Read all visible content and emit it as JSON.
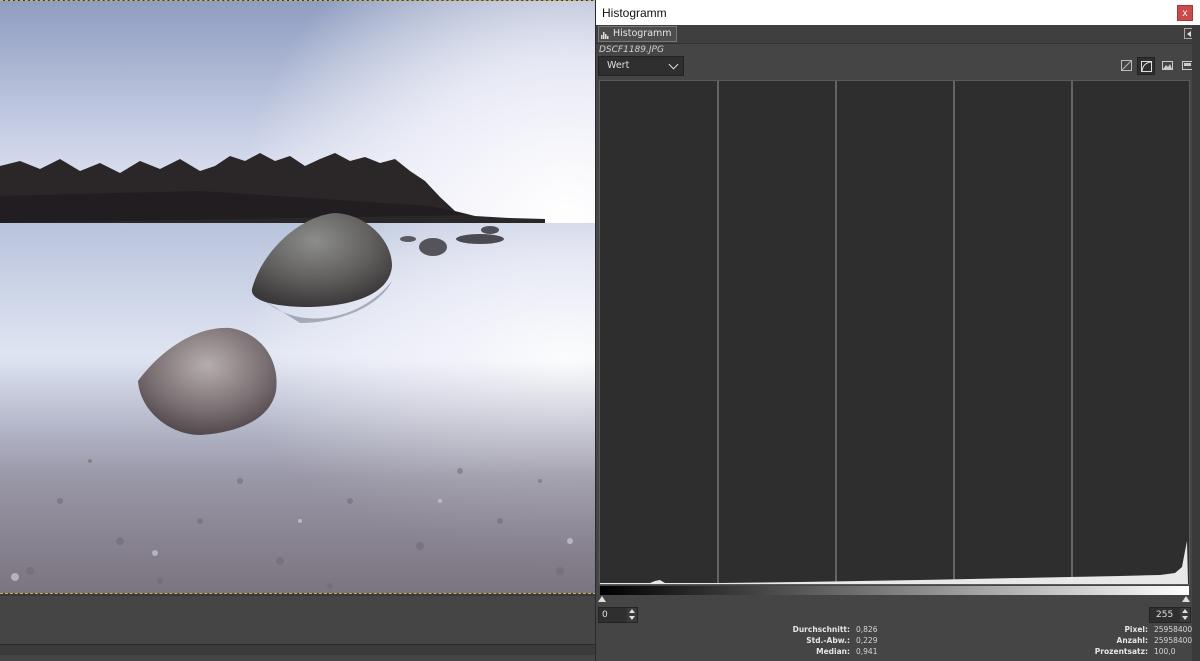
{
  "dialog": {
    "title": "Histogramm",
    "close_label": "x",
    "tab_label": "Histogramm",
    "filename": "DSCF1189.JPG",
    "channel": {
      "selected": "Wert"
    },
    "scale_mode": "logarithmic",
    "range": {
      "low": "0",
      "high": "255"
    }
  },
  "stats": {
    "mean_label": "Durchschnitt:",
    "mean_value": "0,826",
    "stddev_label": "Std.-Abw.:",
    "stddev_value": "0,229",
    "median_label": "Median:",
    "median_value": "0,941",
    "pixels_label": "Pixel:",
    "pixels_value": "25958400",
    "count_label": "Anzahl:",
    "count_value": "25958400",
    "percent_label": "Prozentsatz:",
    "percent_value": "100,0"
  },
  "icons": {
    "tab": "histogram-icon",
    "linear": "linear-scale-icon",
    "log": "log-scale-icon",
    "view1": "image-view-icon",
    "view2": "image-view-alt-icon"
  },
  "colors": {
    "titlebar_close": "#c94a4a",
    "histogram_bg": "#2e2e2e",
    "histogram_fill": "#e8e8e8"
  }
}
